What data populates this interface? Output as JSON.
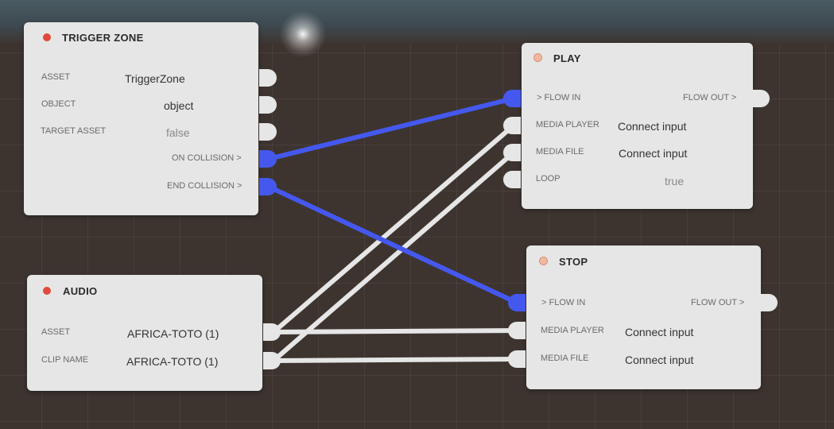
{
  "colors": {
    "flow_wire": "#4558ee",
    "data_wire": "#e6e6e6",
    "node_bg": "#e6e6e6",
    "status_red": "#e04a3a"
  },
  "trigger_zone": {
    "title": "TRIGGER ZONE",
    "rows": [
      {
        "label": "ASSET",
        "value": "TriggerZone"
      },
      {
        "label": "OBJECT",
        "value": "object"
      },
      {
        "label": "TARGET ASSET",
        "value": "false"
      }
    ],
    "outputs": [
      "ON COLLISION  >",
      "END COLLISION  >"
    ]
  },
  "audio": {
    "title": "AUDIO",
    "rows": [
      {
        "label": "ASSET",
        "value": "AFRICA-TOTO (1)"
      },
      {
        "label": "CLIP NAME",
        "value": "AFRICA-TOTO (1)"
      }
    ]
  },
  "play": {
    "title": "PLAY",
    "flow_in": ">  FLOW IN",
    "flow_out": "FLOW OUT  >",
    "rows": [
      {
        "label": "MEDIA PLAYER",
        "value": "Connect input"
      },
      {
        "label": "MEDIA FILE",
        "value": "Connect input"
      },
      {
        "label": "LOOP",
        "value": "true"
      }
    ]
  },
  "stop": {
    "title": "STOP",
    "flow_in": ">  FLOW IN",
    "flow_out": "FLOW OUT  >",
    "rows": [
      {
        "label": "MEDIA PLAYER",
        "value": "Connect input"
      },
      {
        "label": "MEDIA FILE",
        "value": "Connect input"
      }
    ]
  }
}
